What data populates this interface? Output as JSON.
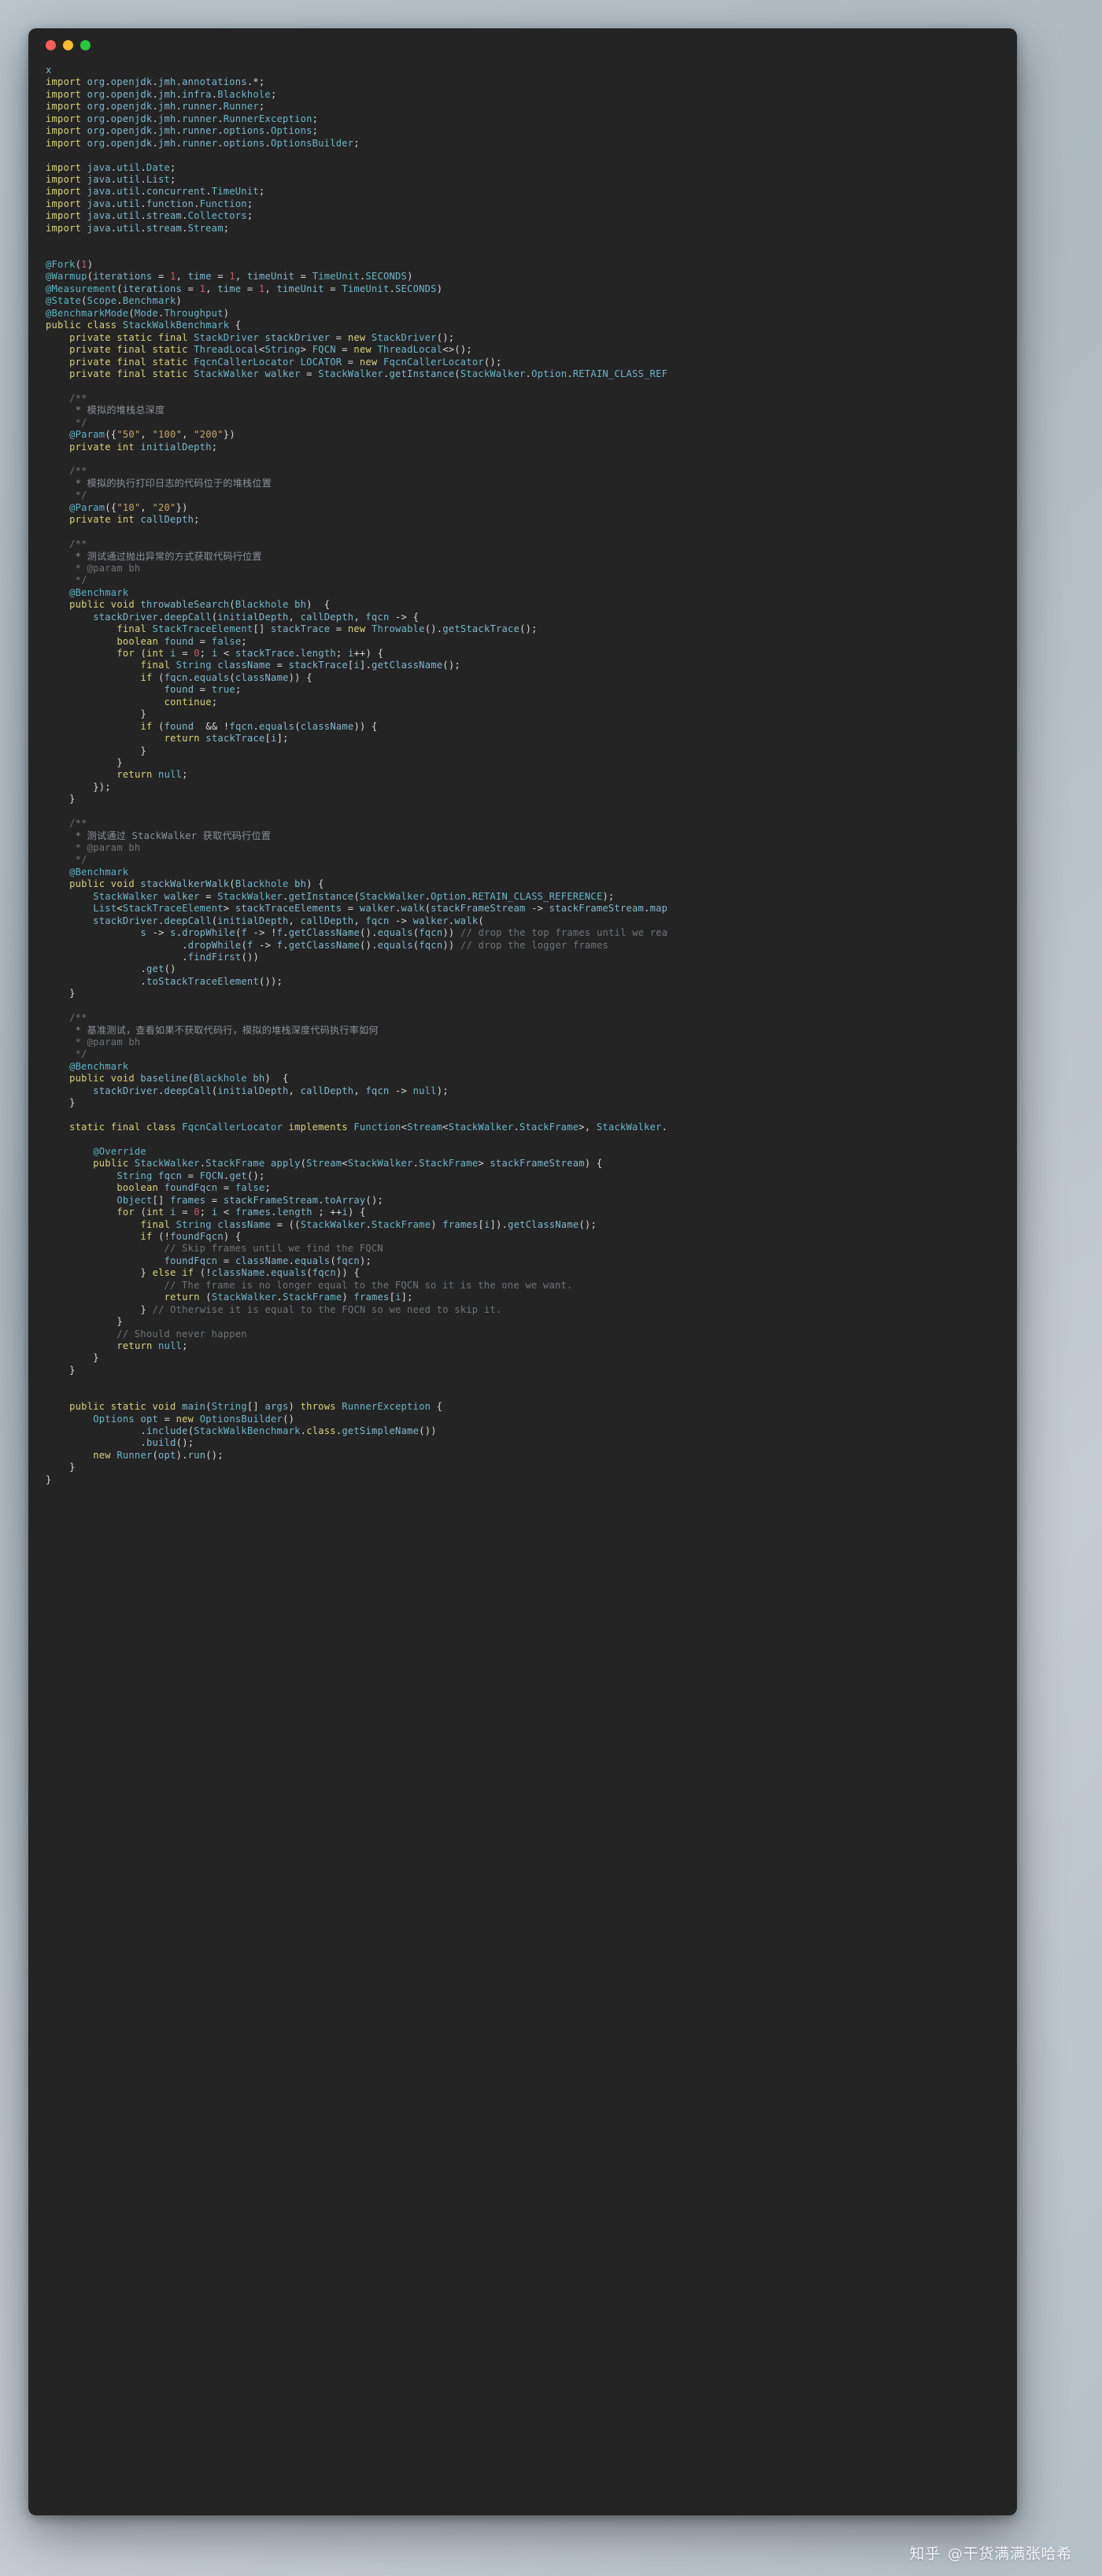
{
  "window": {
    "traffic_lights": [
      "close",
      "minimize",
      "maximize"
    ],
    "theme_background": "#242424",
    "page_background": "#b9c4cc"
  },
  "watermark": {
    "site": "知乎",
    "author": "@干货满满张哈希"
  },
  "code": {
    "language": "java",
    "filename_marker": "x",
    "lines": [
      "x",
      "import org.openjdk.jmh.annotations.*;",
      "import org.openjdk.jmh.infra.Blackhole;",
      "import org.openjdk.jmh.runner.Runner;",
      "import org.openjdk.jmh.runner.RunnerException;",
      "import org.openjdk.jmh.runner.options.Options;",
      "import org.openjdk.jmh.runner.options.OptionsBuilder;",
      "",
      "import java.util.Date;",
      "import java.util.List;",
      "import java.util.concurrent.TimeUnit;",
      "import java.util.function.Function;",
      "import java.util.stream.Collectors;",
      "import java.util.stream.Stream;",
      "",
      "",
      "@Fork(1)",
      "@Warmup(iterations = 1, time = 1, timeUnit = TimeUnit.SECONDS)",
      "@Measurement(iterations = 1, time = 1, timeUnit = TimeUnit.SECONDS)",
      "@State(Scope.Benchmark)",
      "@BenchmarkMode(Mode.Throughput)",
      "public class StackWalkBenchmark {",
      "    private static final StackDriver stackDriver = new StackDriver();",
      "    private final static ThreadLocal<String> FQCN = new ThreadLocal<>();",
      "    private final static FqcnCallerLocator LOCATOR = new FqcnCallerLocator();",
      "    private final static StackWalker walker = StackWalker.getInstance(StackWalker.Option.RETAIN_CLASS_REF",
      "",
      "    /**",
      "     * 模拟的堆栈总深度",
      "     */",
      "    @Param({\"50\", \"100\", \"200\"})",
      "    private int initialDepth;",
      "",
      "    /**",
      "     * 模拟的执行打印日志的代码位于的堆栈位置",
      "     */",
      "    @Param({\"10\", \"20\"})",
      "    private int callDepth;",
      "",
      "    /**",
      "     * 测试通过抛出异常的方式获取代码行位置",
      "     * @param bh",
      "     */",
      "    @Benchmark",
      "    public void throwableSearch(Blackhole bh)  {",
      "        stackDriver.deepCall(initialDepth, callDepth, fqcn -> {",
      "            final StackTraceElement[] stackTrace = new Throwable().getStackTrace();",
      "            boolean found = false;",
      "            for (int i = 0; i < stackTrace.length; i++) {",
      "                final String className = stackTrace[i].getClassName();",
      "                if (fqcn.equals(className)) {",
      "                    found = true;",
      "                    continue;",
      "                }",
      "                if (found  && !fqcn.equals(className)) {",
      "                    return stackTrace[i];",
      "                }",
      "            }",
      "            return null;",
      "        });",
      "    }",
      "",
      "    /**",
      "     * 测试通过 StackWalker 获取代码行位置",
      "     * @param bh",
      "     */",
      "    @Benchmark",
      "    public void stackWalkerWalk(Blackhole bh) {",
      "        StackWalker walker = StackWalker.getInstance(StackWalker.Option.RETAIN_CLASS_REFERENCE);",
      "        List<StackTraceElement> stackTraceElements = walker.walk(stackFrameStream -> stackFrameStream.map",
      "        stackDriver.deepCall(initialDepth, callDepth, fqcn -> walker.walk(",
      "                s -> s.dropWhile(f -> !f.getClassName().equals(fqcn)) // drop the top frames until we rea",
      "                       .dropWhile(f -> f.getClassName().equals(fqcn)) // drop the logger frames",
      "                       .findFirst())",
      "                .get()",
      "                .toStackTraceElement());",
      "    }",
      "",
      "    /**",
      "     * 基准测试，查看如果不获取代码行，模拟的堆栈深度代码执行率如何",
      "     * @param bh",
      "     */",
      "    @Benchmark",
      "    public void baseline(Blackhole bh)  {",
      "        stackDriver.deepCall(initialDepth, callDepth, fqcn -> null);",
      "    }",
      "",
      "    static final class FqcnCallerLocator implements Function<Stream<StackWalker.StackFrame>, StackWalker.",
      "",
      "        @Override",
      "        public StackWalker.StackFrame apply(Stream<StackWalker.StackFrame> stackFrameStream) {",
      "            String fqcn = FQCN.get();",
      "            boolean foundFqcn = false;",
      "            Object[] frames = stackFrameStream.toArray();",
      "            for (int i = 0; i < frames.length ; ++i) {",
      "                final String className = ((StackWalker.StackFrame) frames[i]).getClassName();",
      "                if (!foundFqcn) {",
      "                    // Skip frames until we find the FQCN",
      "                    foundFqcn = className.equals(fqcn);",
      "                } else if (!className.equals(fqcn)) {",
      "                    // The frame is no longer equal to the FQCN so it is the one we want.",
      "                    return (StackWalker.StackFrame) frames[i];",
      "                } // Otherwise it is equal to the FQCN so we need to skip it.",
      "            }",
      "            // Should never happen",
      "            return null;",
      "        }",
      "    }",
      "",
      "",
      "    public static void main(String[] args) throws RunnerException {",
      "        Options opt = new OptionsBuilder()",
      "                .include(StackWalkBenchmark.class.getSimpleName())",
      "                .build();",
      "        new Runner(opt).run();",
      "    }",
      "}"
    ]
  }
}
